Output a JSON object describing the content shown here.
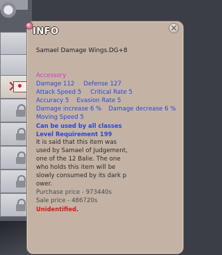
{
  "tooltip": {
    "title": "INFO",
    "close_glyph": "×",
    "item_name": "Samael Damage Wings.DG+8",
    "type": "Accessory",
    "stats": [
      [
        "Damage 112",
        "Defense 127"
      ],
      [
        "Attack Speed 5",
        "Critical Rate 5"
      ],
      [
        "Accuracy 5",
        "Evasion Rate 5"
      ],
      [
        "Damage increase 6 %",
        "Damage decrease 6 %"
      ]
    ],
    "moving_speed": "Moving Speed 5",
    "class_req": "Can be used by all classes",
    "level_req": "Level Requirement 199",
    "description_lines": [
      "It is said that this item was",
      " used by Samael of Judgement,",
      " one of the 12 Balie. The one",
      " who holds this item will be",
      "slowly consumed by its dark p",
      "ower."
    ],
    "purchase_price": "Purchase price - 973440s",
    "sale_price": "Sale price - 486720s",
    "status": "Unidentified."
  },
  "colors": {
    "panel": "#c4b3a5",
    "type": "#cc3bc7",
    "stat": "#2a47d6",
    "unidentified": "#cc1c1c"
  },
  "icons": [
    "winged-emblem-icon",
    "pin-icon",
    "close-icon",
    "lock-icon",
    "cross-icon",
    "envelope-icon"
  ]
}
